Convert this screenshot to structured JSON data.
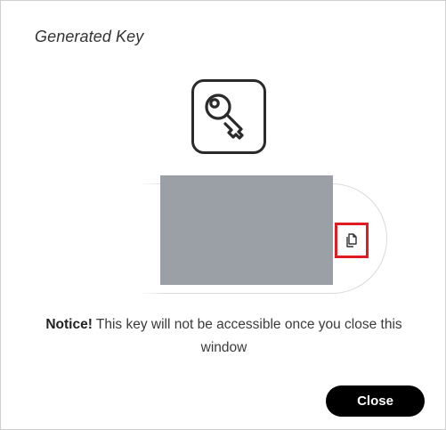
{
  "dialog": {
    "title": "Generated Key",
    "icon": "key-icon",
    "copy_icon": "copy-icon",
    "notice_label": "Notice!",
    "notice_text": " This key will not be accessible once you close this window",
    "close_label": "Close"
  },
  "colors": {
    "redaction": "#9aa0a6",
    "highlight": "#e11b22",
    "button_bg": "#000000"
  }
}
